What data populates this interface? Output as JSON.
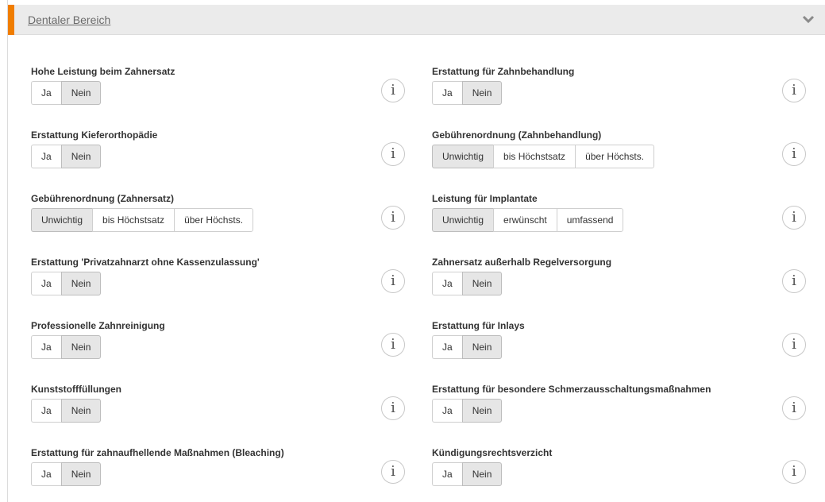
{
  "section": {
    "title": "Dentaler Bereich",
    "toggle_icon": "chevron-down-icon"
  },
  "info_icon": "i",
  "left": [
    {
      "label": "Hohe Leistung beim Zahnersatz",
      "options": [
        "Ja",
        "Nein"
      ],
      "selected": 1
    },
    {
      "label": "Erstattung Kieferorthopädie",
      "options": [
        "Ja",
        "Nein"
      ],
      "selected": 1
    },
    {
      "label": "Gebührenordnung (Zahnersatz)",
      "options": [
        "Unwichtig",
        "bis Höchstsatz",
        "über Höchsts."
      ],
      "selected": 0
    },
    {
      "label": "Erstattung 'Privatzahnarzt ohne Kassenzulassung'",
      "options": [
        "Ja",
        "Nein"
      ],
      "selected": 1
    },
    {
      "label": "Professionelle Zahnreinigung",
      "options": [
        "Ja",
        "Nein"
      ],
      "selected": 1
    },
    {
      "label": "Kunststofffüllungen",
      "options": [
        "Ja",
        "Nein"
      ],
      "selected": 1
    },
    {
      "label": "Erstattung für zahnaufhellende Maßnahmen (Bleaching)",
      "options": [
        "Ja",
        "Nein"
      ],
      "selected": 1
    }
  ],
  "right": [
    {
      "label": "Erstattung für Zahnbehandlung",
      "options": [
        "Ja",
        "Nein"
      ],
      "selected": 1
    },
    {
      "label": "Gebührenordnung (Zahnbehandlung)",
      "options": [
        "Unwichtig",
        "bis Höchstsatz",
        "über Höchsts."
      ],
      "selected": 0
    },
    {
      "label": "Leistung für Implantate",
      "options": [
        "Unwichtig",
        "erwünscht",
        "umfassend"
      ],
      "selected": 0
    },
    {
      "label": "Zahnersatz außerhalb Regelversorgung",
      "options": [
        "Ja",
        "Nein"
      ],
      "selected": 1
    },
    {
      "label": "Erstattung für Inlays",
      "options": [
        "Ja",
        "Nein"
      ],
      "selected": 1
    },
    {
      "label": "Erstattung für besondere Schmerzausschaltungsmaßnahmen",
      "options": [
        "Ja",
        "Nein"
      ],
      "selected": 1
    },
    {
      "label": "Kündigungsrechtsverzicht",
      "options": [
        "Ja",
        "Nein"
      ],
      "selected": 1
    }
  ],
  "colors": {
    "accent": "#f07d00",
    "header_bg": "#ebebeb",
    "active_bg": "#e6e6e6"
  }
}
